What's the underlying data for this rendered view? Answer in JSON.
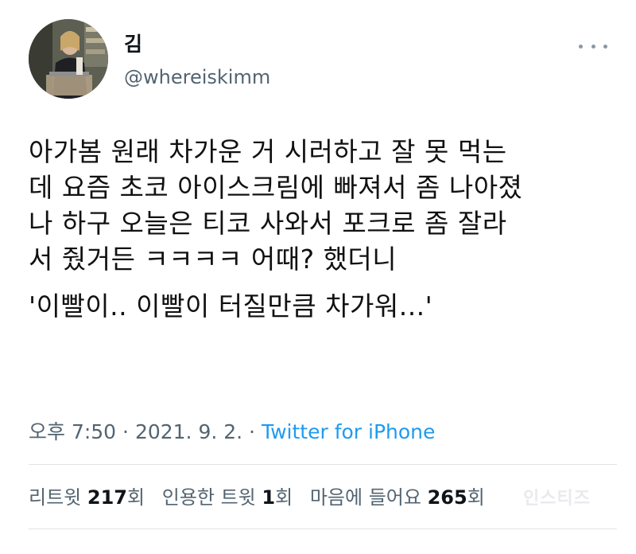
{
  "author": {
    "display_name": "김",
    "handle": "@whereiskimm"
  },
  "icons": {
    "more": "more-horizontal-icon",
    "avatar": "profile-photo"
  },
  "tweet": {
    "lines": [
      "아가봄 원래 차가운 거 시러하고 잘 못 먹는",
      "데 요즘 초코 아이스크림에 빠져서 좀 나아졌",
      "나 하구 오늘은 티코 사와서 포크로 좀 잘라",
      "서 줬거든 ㅋㅋㅋㅋ 어때? 했더니"
    ],
    "quote": "'이빨이.. 이빨이 터질만큼 차가워...'"
  },
  "meta": {
    "time": "오후 7:50",
    "separator": " · ",
    "date": "2021. 9. 2.",
    "separator2": " · ",
    "source": "Twitter for iPhone"
  },
  "stats": {
    "retweets_label": "리트윗",
    "retweets_count": "217",
    "retweets_unit": "회",
    "quotes_label": "인용한 트윗",
    "quotes_count": "1",
    "quotes_unit": "회",
    "likes_label": "마음에 들어요",
    "likes_count": "265",
    "likes_unit": "회"
  },
  "colors": {
    "text": "#0f1419",
    "secondary": "#536471",
    "link": "#1d9bf0",
    "divider": "#dfe3e6"
  },
  "watermark": "인스티즈"
}
